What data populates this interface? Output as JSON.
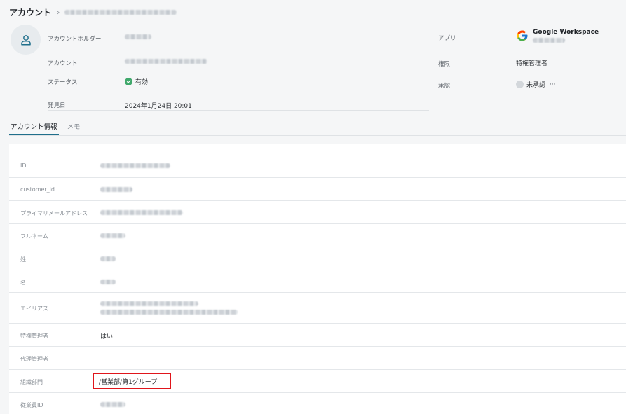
{
  "breadcrumb": {
    "title": "アカウント",
    "separator": "›"
  },
  "account": {
    "holder_label": "アカウントホルダー",
    "account_label": "アカウント",
    "status_label": "ステータス",
    "status_value": "有効",
    "discovered_label": "発見日",
    "discovered_value": "2024年1月24日 20:01"
  },
  "app": {
    "app_label": "アプリ",
    "app_name": "Google Workspace",
    "permission_label": "権限",
    "permission_value": "特権管理者",
    "approval_label": "承認",
    "approval_value": "未承認",
    "more": "···"
  },
  "tabs": [
    {
      "label": "アカウント情報",
      "active": true
    },
    {
      "label": "メモ",
      "active": false
    }
  ],
  "details": [
    {
      "label": "ID",
      "value": ""
    },
    {
      "label": "customer_id",
      "value": ""
    },
    {
      "label": "プライマリメールアドレス",
      "value": ""
    },
    {
      "label": "フルネーム",
      "value": ""
    },
    {
      "label": "姓",
      "value": ""
    },
    {
      "label": "名",
      "value": ""
    },
    {
      "label": "エイリアス",
      "value": ""
    },
    {
      "label": "特権管理者",
      "value": "はい"
    },
    {
      "label": "代理管理者",
      "value": ""
    },
    {
      "label": "組織部門",
      "value": "/営業部/第1グループ"
    },
    {
      "label": "従業員ID",
      "value": ""
    }
  ],
  "colors": {
    "status_ok": "#3fa86b",
    "highlight": "#e0151b",
    "tab_active": "#1f6f8b"
  }
}
